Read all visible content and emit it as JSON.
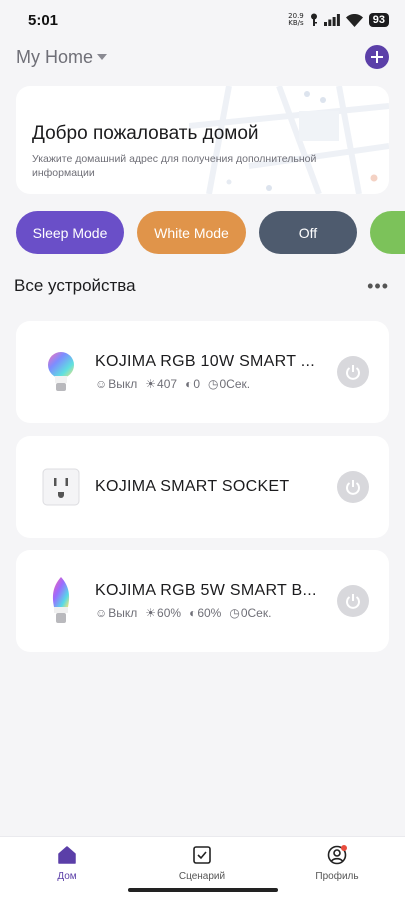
{
  "status_bar": {
    "time": "5:01",
    "net_speed_value": "20.9",
    "net_speed_unit": "KB/s",
    "battery": "93"
  },
  "header": {
    "home_name": "My Home"
  },
  "welcome": {
    "title": "Добро пожаловать домой",
    "subtitle": "Укажите домашний адрес для получения дополнительной информации"
  },
  "modes": [
    {
      "label": "Sleep Mode",
      "color": "#6a4fc8"
    },
    {
      "label": "White Mode",
      "color": "#e0944a"
    },
    {
      "label": "Off",
      "color": "#4e5b6e"
    },
    {
      "label": "",
      "color": "#7cc25a"
    }
  ],
  "devices_section": {
    "title": "Все устройства",
    "more": "•••"
  },
  "devices": [
    {
      "name": "KOJIMA RGB 10W SMART ...",
      "state": "Выкл",
      "brightness": "407",
      "temperature": "0",
      "timer": "0Сек."
    },
    {
      "name": "KOJIMA SMART SOCKET"
    },
    {
      "name": "KOJIMA RGB 5W SMART B...",
      "state": "Выкл",
      "brightness": "60%",
      "temperature": "60%",
      "timer": "0Сек."
    }
  ],
  "bottom_nav": [
    {
      "label": "Дом",
      "active": true
    },
    {
      "label": "Сценарий",
      "active": false
    },
    {
      "label": "Профиль",
      "active": false
    }
  ],
  "colors": {
    "accent": "#5b3fa8",
    "notification_dot": "#e84c3d"
  }
}
